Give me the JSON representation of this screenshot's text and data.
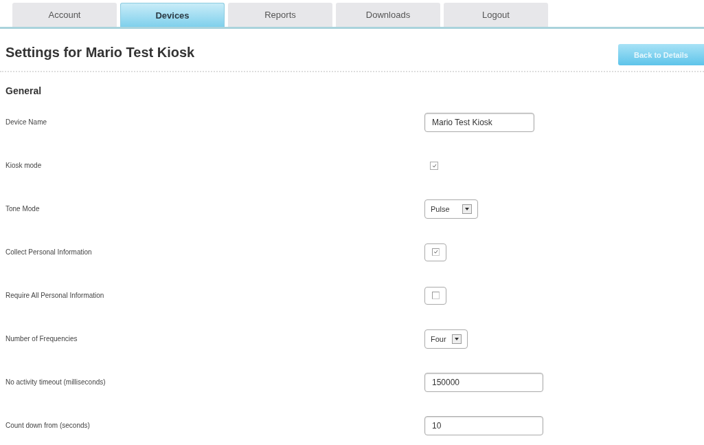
{
  "tabs": [
    {
      "label": "Account",
      "selected": false
    },
    {
      "label": "Devices",
      "selected": true
    },
    {
      "label": "Reports",
      "selected": false
    },
    {
      "label": "Downloads",
      "selected": false
    },
    {
      "label": "Logout",
      "selected": false
    }
  ],
  "title": "Settings for Mario Test Kiosk",
  "back_button": "Back to Details",
  "section": "General",
  "fields": [
    {
      "label": "Device Name",
      "kind": "text",
      "value": "Mario Test Kiosk"
    },
    {
      "label": "Kiosk mode",
      "kind": "checkbox",
      "checked": true
    },
    {
      "label": "Tone Mode",
      "kind": "select",
      "value": "Pulse"
    },
    {
      "label": "Collect Personal Information",
      "kind": "boxed_checkbox",
      "checked": true
    },
    {
      "label": "Require All Personal Information",
      "kind": "boxed_checkbox",
      "checked": false
    },
    {
      "label": "Number of Frequencies",
      "kind": "select",
      "value": "Four"
    },
    {
      "label": "No activity timeout (milliseconds)",
      "kind": "text",
      "value": "150000"
    },
    {
      "label": "Count down from (seconds)",
      "kind": "text",
      "value": "10"
    }
  ]
}
